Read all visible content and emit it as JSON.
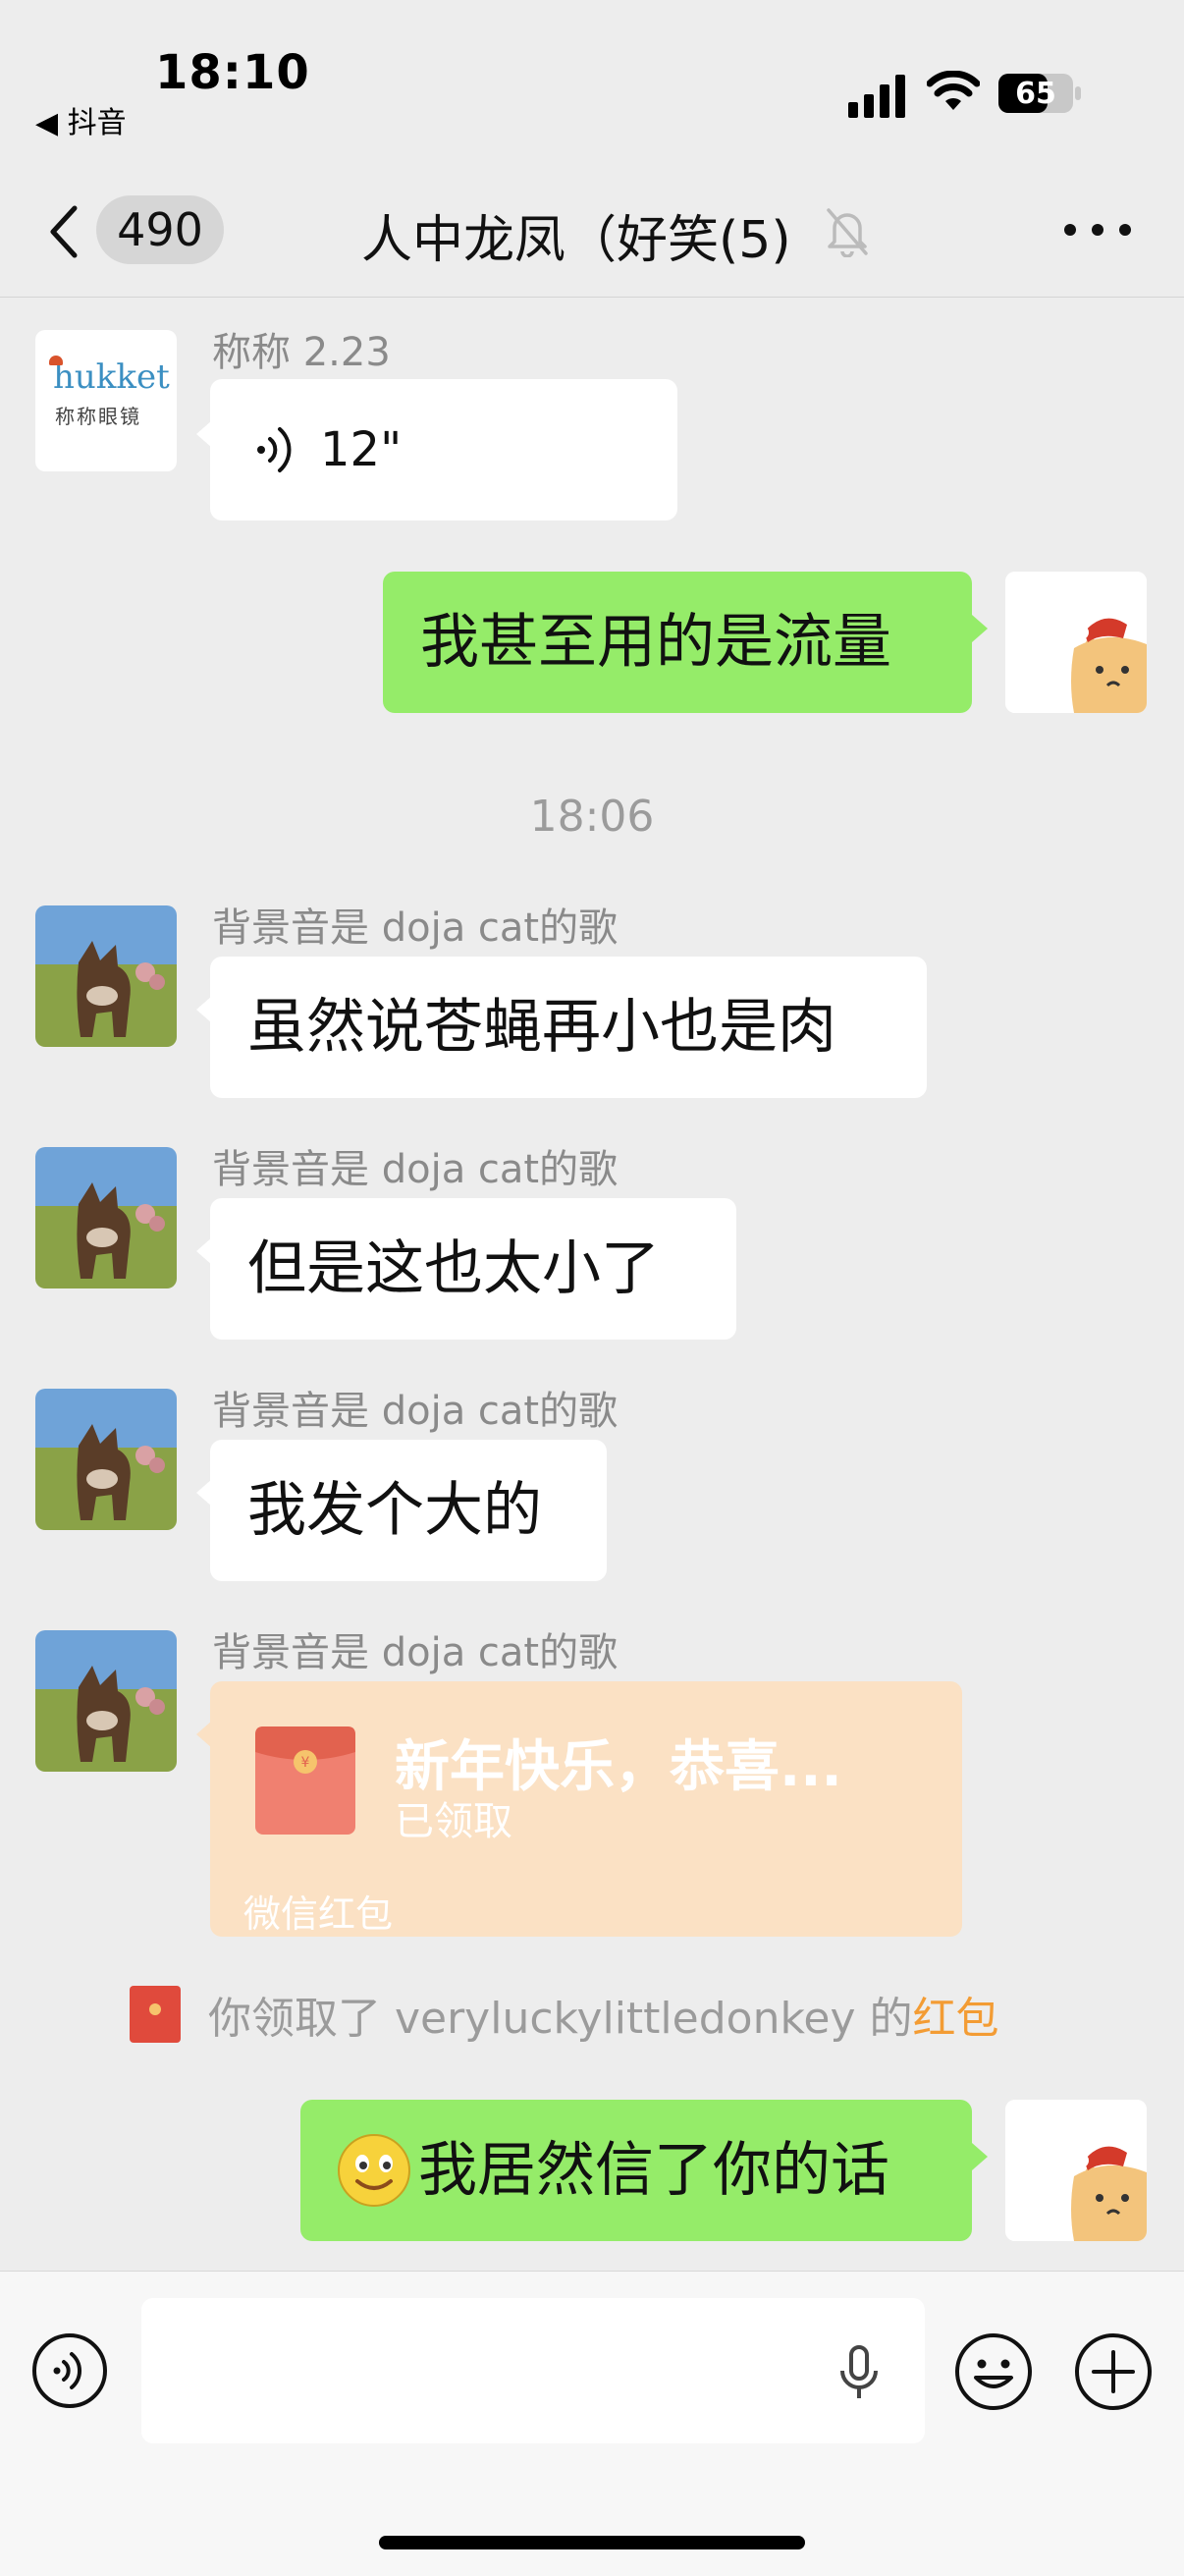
{
  "status_bar": {
    "time": "18:10",
    "back_app": "◀ 抖音",
    "battery": "65"
  },
  "nav": {
    "unread_count": "490",
    "title": "人中龙凤（好笑(5)"
  },
  "messages": [
    {
      "sender": "称称 2.23",
      "voice_duration": "12\"",
      "avatar_text_top": "hukket",
      "avatar_text_bottom": "称称眼镜"
    },
    {
      "text": "我甚至用的是流量"
    },
    {
      "sender": "背景音是 doja cat的歌",
      "text": "虽然说苍蝇再小也是肉"
    },
    {
      "sender": "背景音是 doja cat的歌",
      "text": "但是这也太小了"
    },
    {
      "sender": "背景音是 doja cat的歌",
      "text": "我发个大的"
    },
    {
      "sender": "背景音是 doja cat的歌",
      "red_packet": {
        "title": "新年快乐，恭喜...",
        "status": "已领取",
        "footer": "微信红包"
      }
    },
    {
      "text": "我居然信了你的话"
    }
  ],
  "timestamp": "18:06",
  "system_notice": {
    "prefix": "你领取了 veryluckylittledonkey 的",
    "link": "红包"
  },
  "input": {
    "value": ""
  },
  "colors": {
    "out_bubble": "#95ec69",
    "red_packet": "#fbe1c4",
    "link": "#f39c34"
  }
}
